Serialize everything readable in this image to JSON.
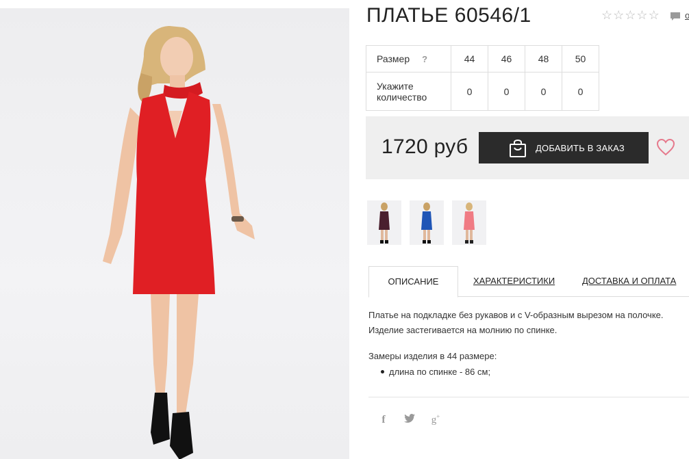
{
  "product": {
    "title": "ПЛАТЬЕ 60546/1",
    "rating": {
      "filled": 0,
      "max": 5
    },
    "comments_link": "о",
    "main_image": {
      "alt": "red sleeveless dress",
      "dress_color": "#e01f24"
    }
  },
  "sizes": {
    "label": "Размер",
    "help": "?",
    "values": [
      "44",
      "46",
      "48",
      "50"
    ],
    "qty_label_line1": "Укажите",
    "qty_label_line2": "количество",
    "quantities": [
      "0",
      "0",
      "0",
      "0"
    ]
  },
  "order": {
    "price": "1720 руб",
    "add_button": "ДОБАВИТЬ В ЗАКАЗ",
    "heart_color": "#e6798c"
  },
  "thumbnails": [
    {
      "color": "#4a1f2e",
      "name": "burgundy"
    },
    {
      "color": "#1f55b6",
      "name": "blue"
    },
    {
      "color": "#f07b84",
      "name": "pink"
    }
  ],
  "tabs": [
    {
      "label": "ОПИСАНИЕ",
      "active": true
    },
    {
      "label": "ХАРАКТЕРИСТИКИ",
      "active": false
    },
    {
      "label": "ДОСТАВКА И ОПЛАТА",
      "active": false
    }
  ],
  "description": {
    "line1": "Платье на подкладке без рукавов и с V-образным вырезом на полочке.",
    "line2": "Изделие застегивается на молнию по спинке.",
    "measures_title": "Замеры изделия в 44 размере:",
    "measures": [
      "длина по спинке - 86 см;"
    ]
  },
  "social": {
    "facebook": "f",
    "twitter": "twitter-icon",
    "googleplus": "g"
  }
}
